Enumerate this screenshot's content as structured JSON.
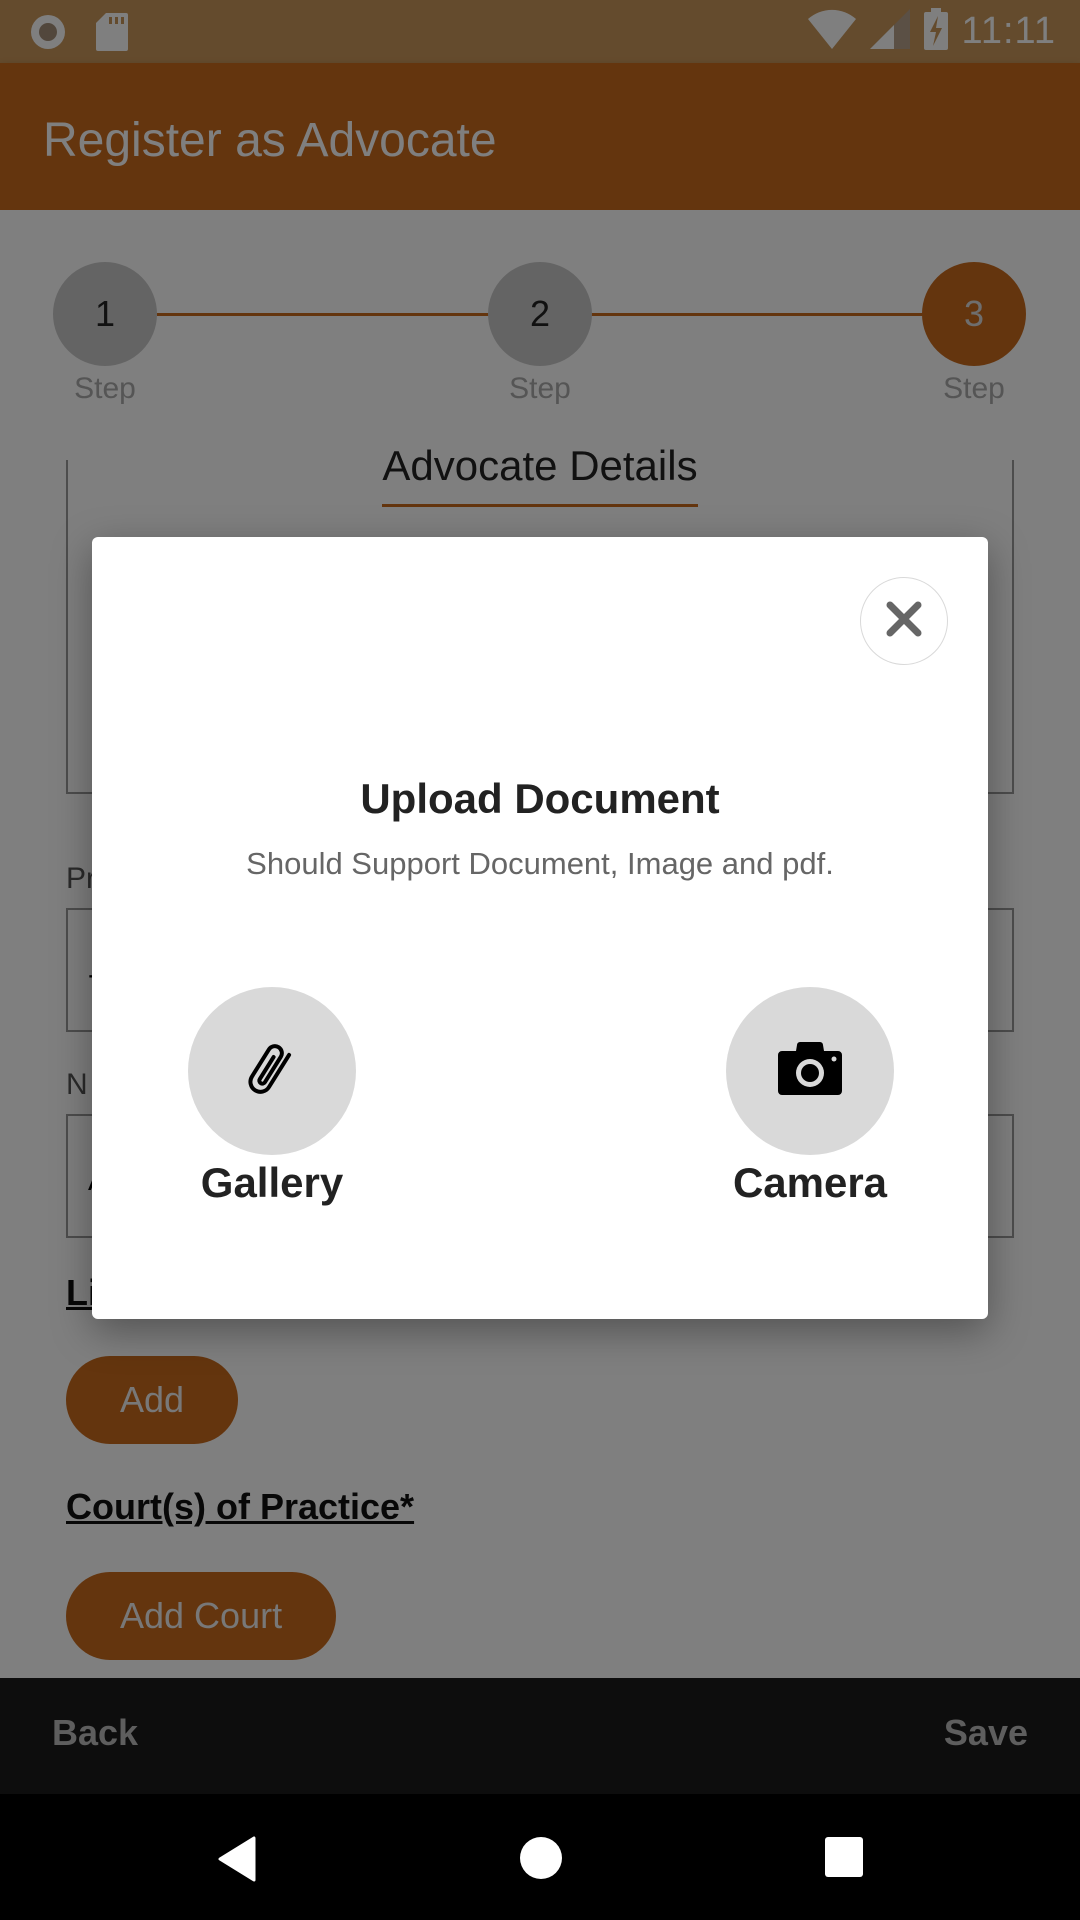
{
  "status_bar": {
    "time": "11:11",
    "left_icons": [
      "record-icon",
      "sd-card-icon"
    ],
    "right_icons": [
      "wifi-icon",
      "cell-signal-icon",
      "battery-charging-icon"
    ]
  },
  "app_bar": {
    "title": "Register as Advocate"
  },
  "stepper": {
    "steps": [
      {
        "number": "1",
        "label": "Step",
        "active": false
      },
      {
        "number": "2",
        "label": "Step",
        "active": false
      },
      {
        "number": "3",
        "label": "Step",
        "active": true
      }
    ]
  },
  "section_title": "Advocate Details",
  "form": {
    "fields": [
      {
        "label_partial": "Pr",
        "value_partial": "-"
      },
      {
        "label_partial": "N",
        "value_partial": "A"
      }
    ],
    "licence_heading_partial": "Li",
    "add_button": "Add",
    "courts_heading": "Court(s) of Practice*",
    "add_court_button": "Add Court"
  },
  "bottom_bar": {
    "back": "Back",
    "save": "Save"
  },
  "modal": {
    "title": "Upload Document",
    "subtitle": "Should Support Document, Image and pdf.",
    "close_icon": "close-icon",
    "options": [
      {
        "label": "Gallery",
        "icon": "paperclip-icon"
      },
      {
        "label": "Camera",
        "icon": "camera-icon"
      }
    ]
  },
  "colors": {
    "accent": "#c96a1d",
    "status_bar": "#c9965a",
    "option_circle": "#d9d9d9"
  }
}
